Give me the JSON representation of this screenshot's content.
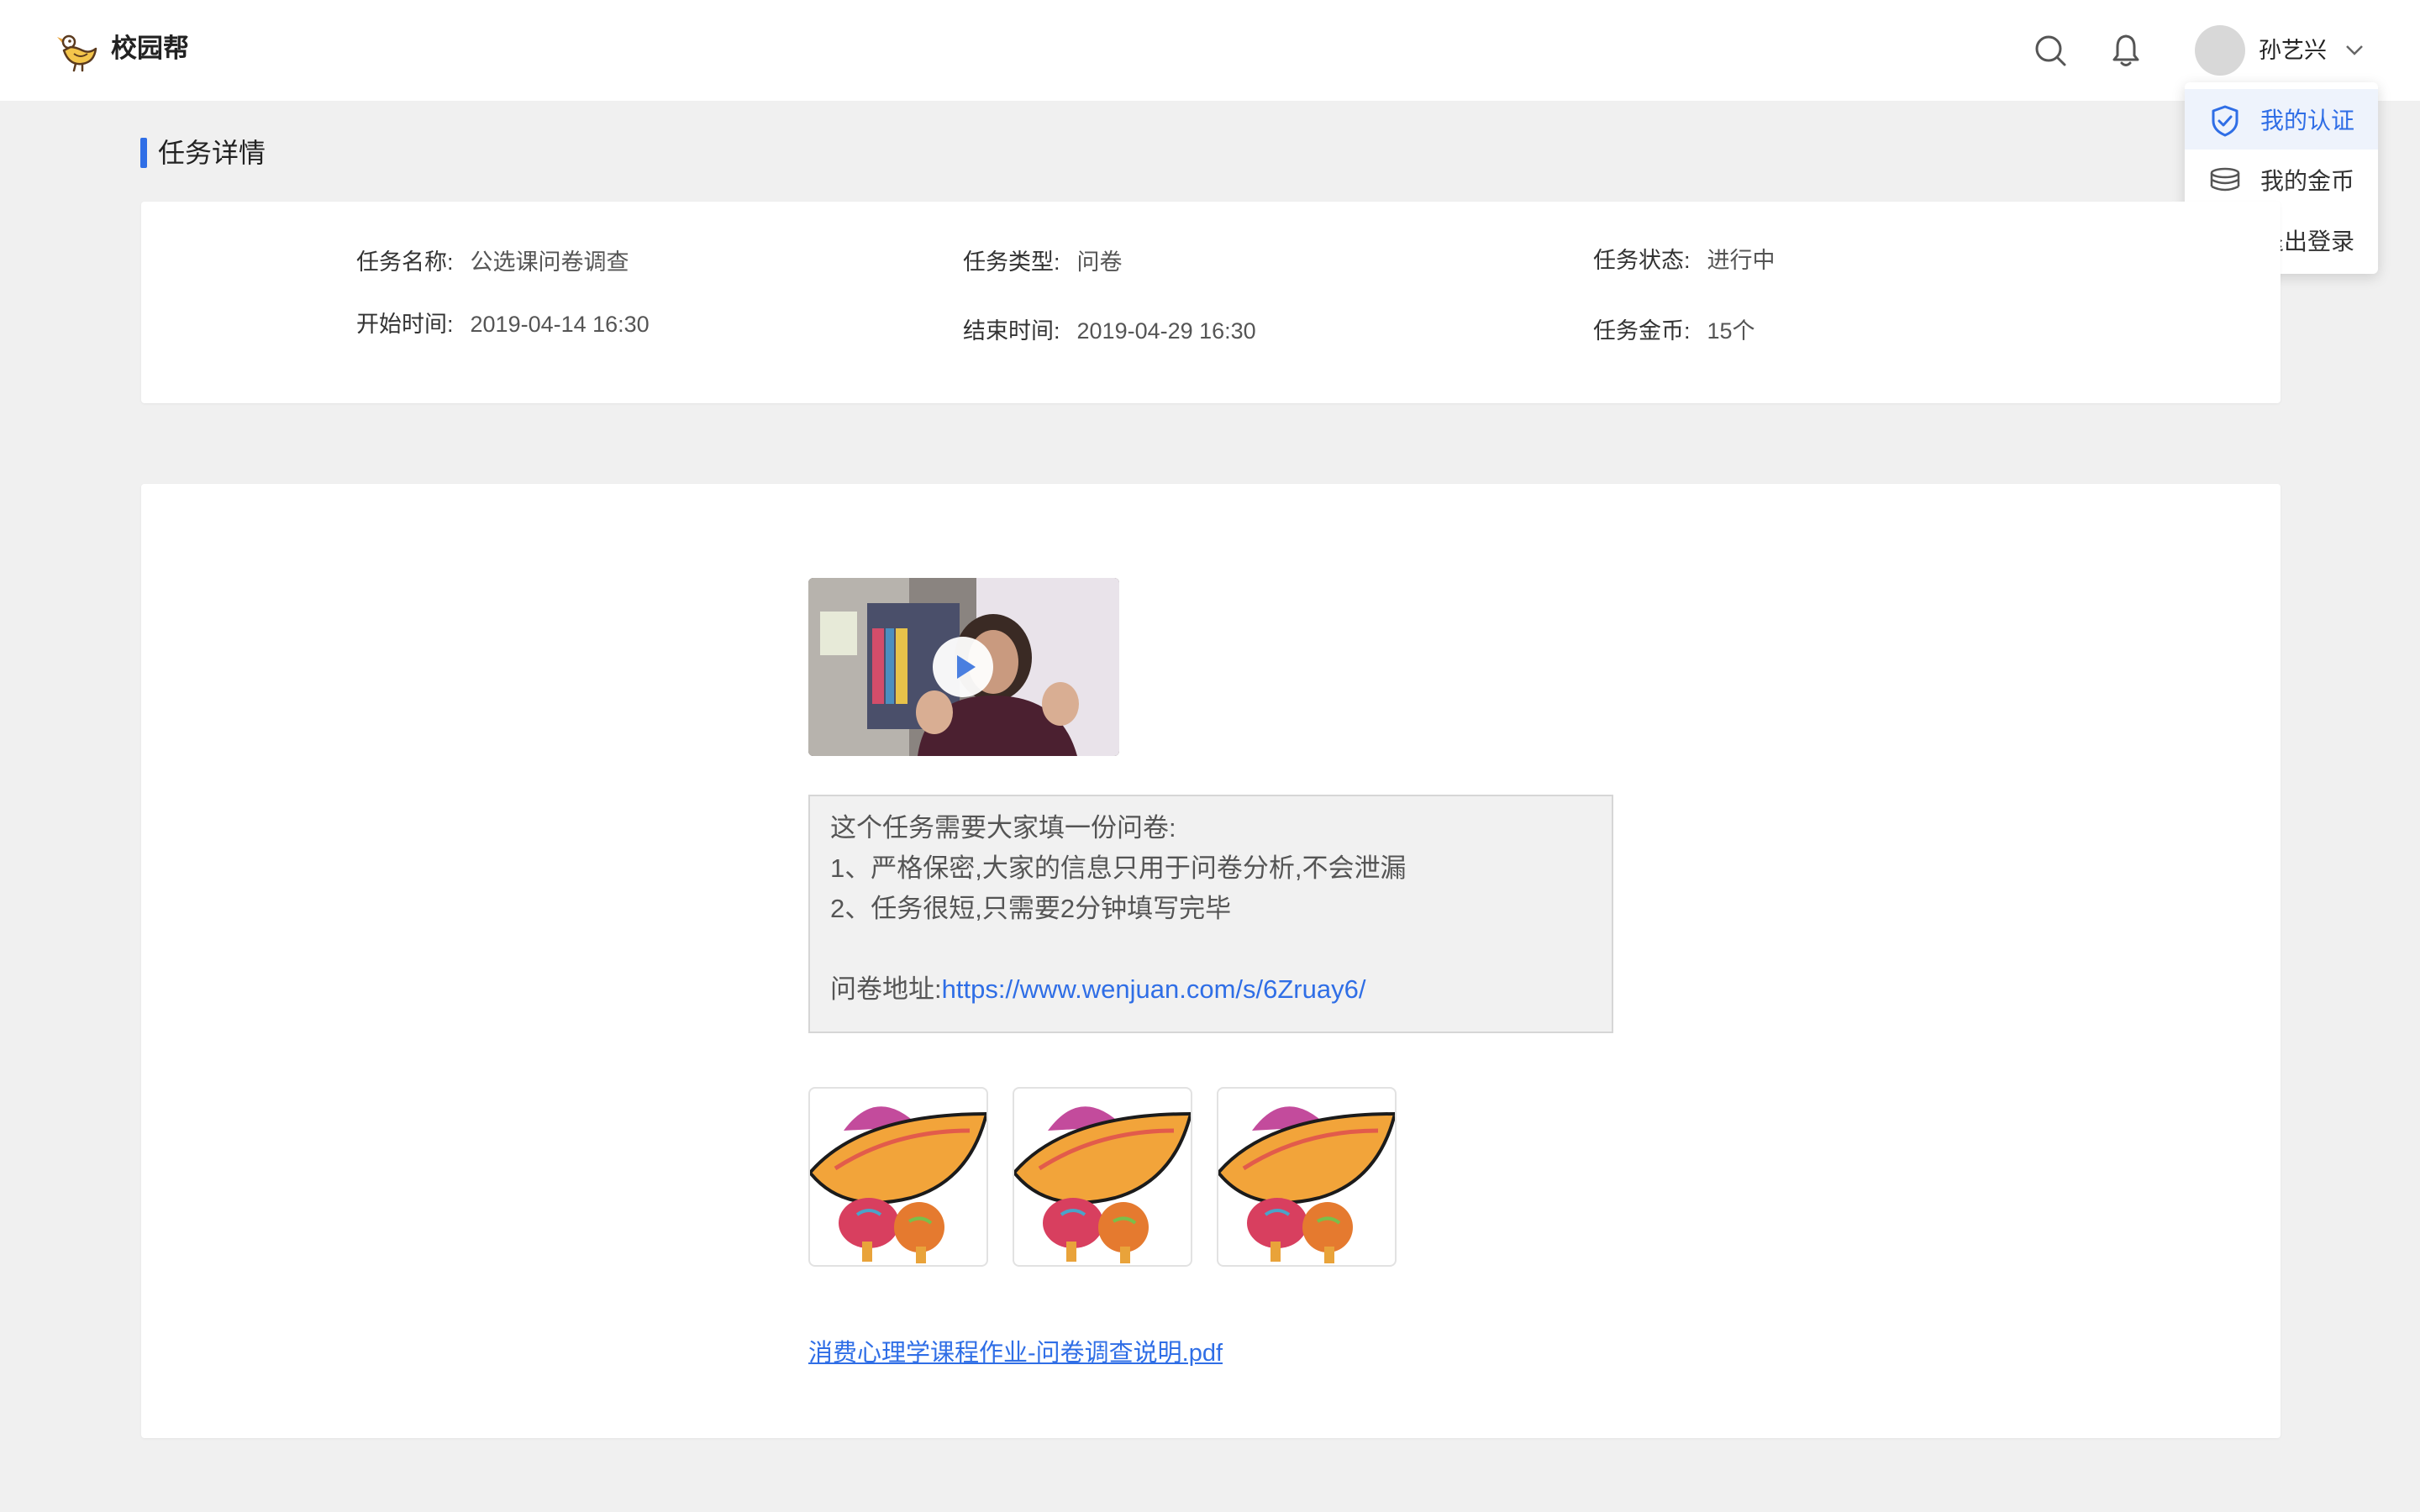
{
  "header": {
    "brand": "校园帮",
    "username": "孙艺兴",
    "icons": {
      "search": "search-icon",
      "bell": "bell-icon",
      "chevron": "chevron-down-icon",
      "logo": "duck-logo-icon"
    }
  },
  "user_menu": {
    "items": [
      {
        "label": "我的认证",
        "icon": "shield-check-icon",
        "active": true
      },
      {
        "label": "我的金币",
        "icon": "coins-stack-icon",
        "active": false
      },
      {
        "label": "退出登录",
        "icon": "power-icon",
        "active": false
      }
    ]
  },
  "section": {
    "title": "任务详情"
  },
  "task_info": {
    "name_label": "任务名称:",
    "name": "公选课问卷调查",
    "type_label": "任务类型:",
    "type": "问卷",
    "status_label": "任务状态:",
    "status": "进行中",
    "start_label": "开始时间:",
    "start": "2019-04-14 16:30",
    "end_label": "结束时间:",
    "end": "2019-04-29 16:30",
    "coins_label": "任务金币:",
    "coins": "15个"
  },
  "content": {
    "video": {
      "icon": "play-icon"
    },
    "description": {
      "line1": "这个任务需要大家填一份问卷:",
      "line2": "1、严格保密,大家的信息只用于问卷分析,不会泄漏",
      "line3": "2、任务很短,只需要2分钟填写完毕",
      "url_label": "问卷地址:",
      "url": "https://www.wenjuan.com/s/6Zruay6/"
    },
    "images": [
      "fiesta-sombrero-image",
      "fiesta-sombrero-image",
      "fiesta-sombrero-image"
    ],
    "attachment": "消费心理学课程作业-问卷调查说明.pdf"
  },
  "colors": {
    "accent": "#2f6ee6",
    "background": "#f0f0f0",
    "card": "#ffffff"
  }
}
